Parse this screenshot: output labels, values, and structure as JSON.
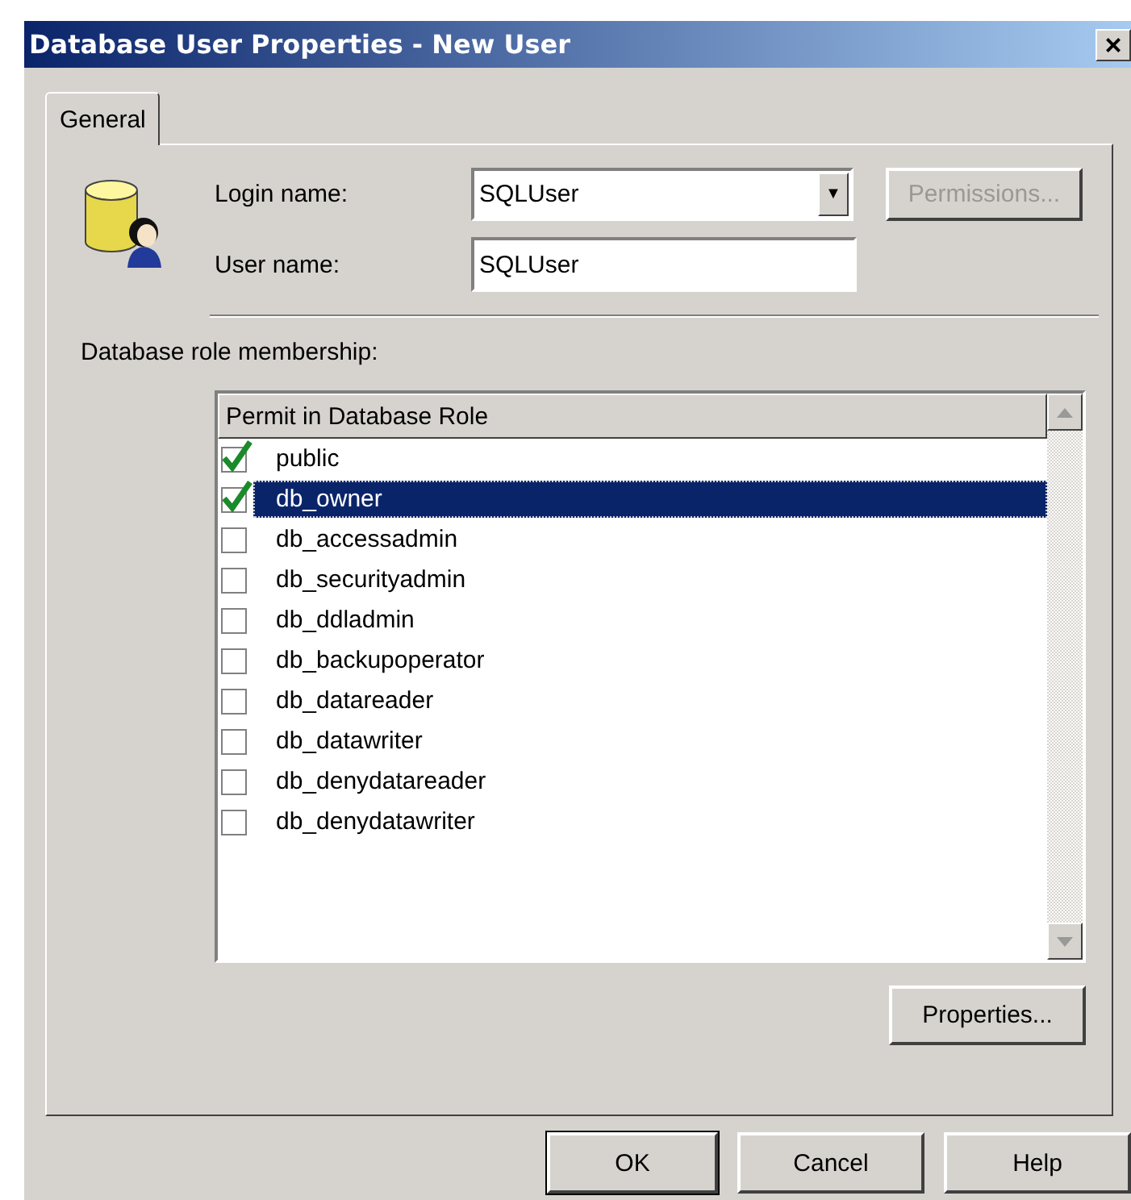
{
  "window": {
    "title": "Database User Properties - New User",
    "close": "×"
  },
  "tabs": [
    {
      "label": "General",
      "selected": true
    }
  ],
  "login": {
    "label": "Login name:",
    "value": "SQLUser",
    "dropdown": "▼"
  },
  "permissions_button": {
    "label": "Permissions...",
    "disabled": true
  },
  "user": {
    "label": "User name:",
    "value": "SQLUser"
  },
  "roles_label": "Database role membership:",
  "roles": {
    "column": "Permit in Database Role",
    "rows": [
      {
        "name": "public",
        "checked": true,
        "selected": false
      },
      {
        "name": "db_owner",
        "checked": true,
        "selected": true
      },
      {
        "name": "db_accessadmin",
        "checked": false,
        "selected": false
      },
      {
        "name": "db_securityadmin",
        "checked": false,
        "selected": false
      },
      {
        "name": "db_ddladmin",
        "checked": false,
        "selected": false
      },
      {
        "name": "db_backupoperator",
        "checked": false,
        "selected": false
      },
      {
        "name": "db_datareader",
        "checked": false,
        "selected": false
      },
      {
        "name": "db_datawriter",
        "checked": false,
        "selected": false
      },
      {
        "name": "db_denydatareader",
        "checked": false,
        "selected": false
      },
      {
        "name": "db_denydatawriter",
        "checked": false,
        "selected": false
      }
    ]
  },
  "properties_button": "Properties...",
  "buttons": [
    "OK",
    "Cancel",
    "Help"
  ]
}
